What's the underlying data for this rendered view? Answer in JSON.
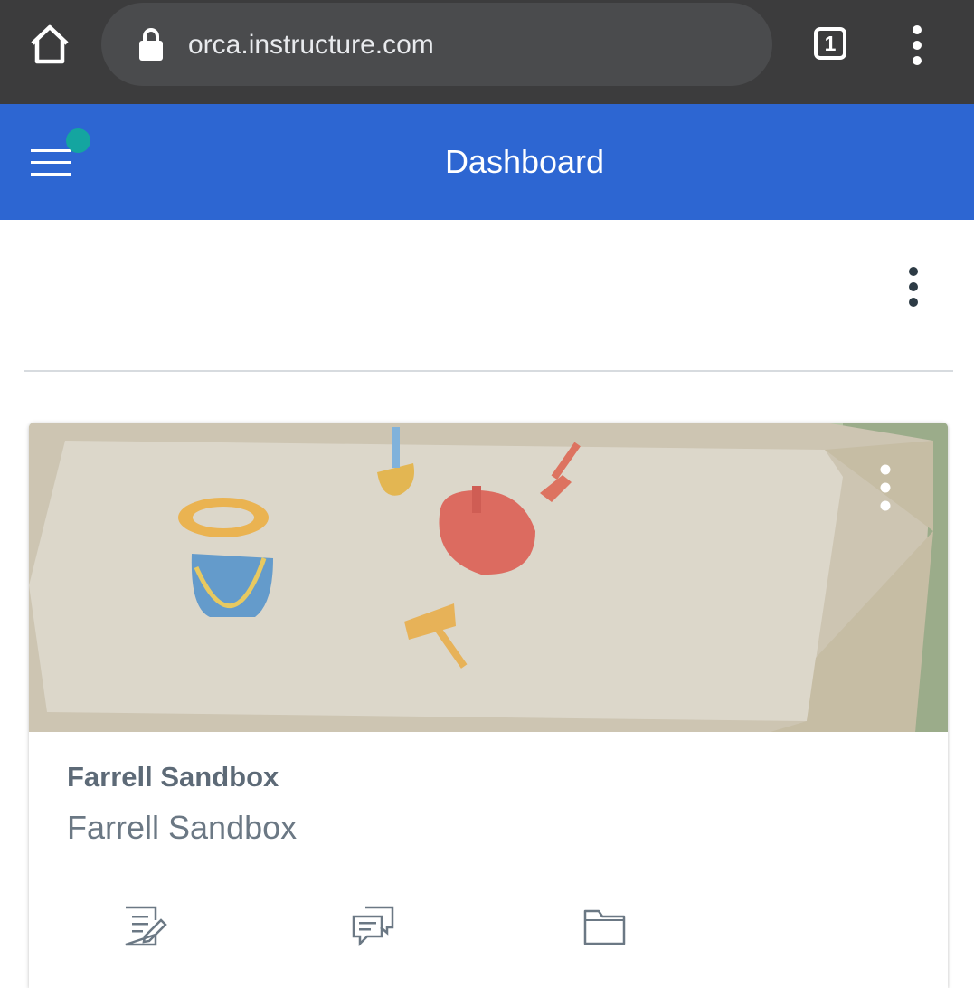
{
  "browser": {
    "url": "orca.instructure.com",
    "tab_count": "1",
    "icons": [
      "home-icon",
      "lock-icon",
      "tab-switcher-icon",
      "more-vertical-icon"
    ]
  },
  "header": {
    "title": "Dashboard",
    "background_color": "#2d66d2",
    "notification_dot_color": "#14a5a0"
  },
  "course_card": {
    "title": "Farrell Sandbox",
    "subtitle": "Farrell Sandbox",
    "actions": [
      {
        "icon": "assignments-icon"
      },
      {
        "icon": "discussions-icon"
      },
      {
        "icon": "files-icon"
      }
    ]
  }
}
